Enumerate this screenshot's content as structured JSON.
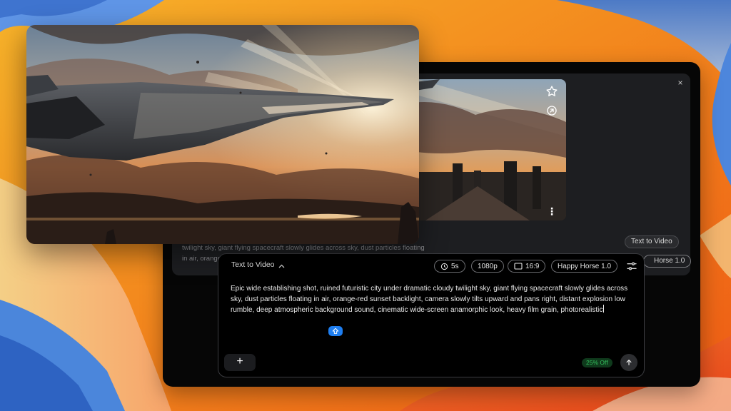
{
  "preview": {
    "alt": "Spacecraft flying over ruined city at sunset"
  },
  "panel": {
    "close_label": "×",
    "thumbnail_actions": [
      "star-icon",
      "share-icon",
      "more-icon"
    ],
    "more_label": "⋮",
    "mode_chip_label": "Text to Video",
    "model_chip_label": "Horse 1.0",
    "prompt_preview": "twilight sky, giant flying spacecraft slowly glides across sky, dust particles floating in air, orange-red sunset backlight, camera slowly tilts upward and pans right,"
  },
  "composer": {
    "mode_label": "Text to Video",
    "mode_chevron": "⌃",
    "duration": "5s",
    "resolution": "1080p",
    "aspect_ratio": "16:9",
    "model": "Happy Horse 1.0",
    "prompt": "Epic wide establishing shot, ruined futuristic city under dramatic cloudy twilight sky, giant flying spacecraft slowly glides across sky, dust particles floating in air, orange-red sunset backlight, camera slowly tilts upward and pans right, distant explosion low rumble, deep atmospheric background sound, cinematic wide-screen anamorphic look, heavy film grain, photorealistic",
    "add_label": "+",
    "discount": "25% Off",
    "submit_icon": "arrow-up-icon"
  },
  "colors": {
    "accent": "#1e7ef0",
    "discount_text": "#35c05e",
    "discount_bg": "#0f3a1c",
    "window_bg": "#060606"
  }
}
